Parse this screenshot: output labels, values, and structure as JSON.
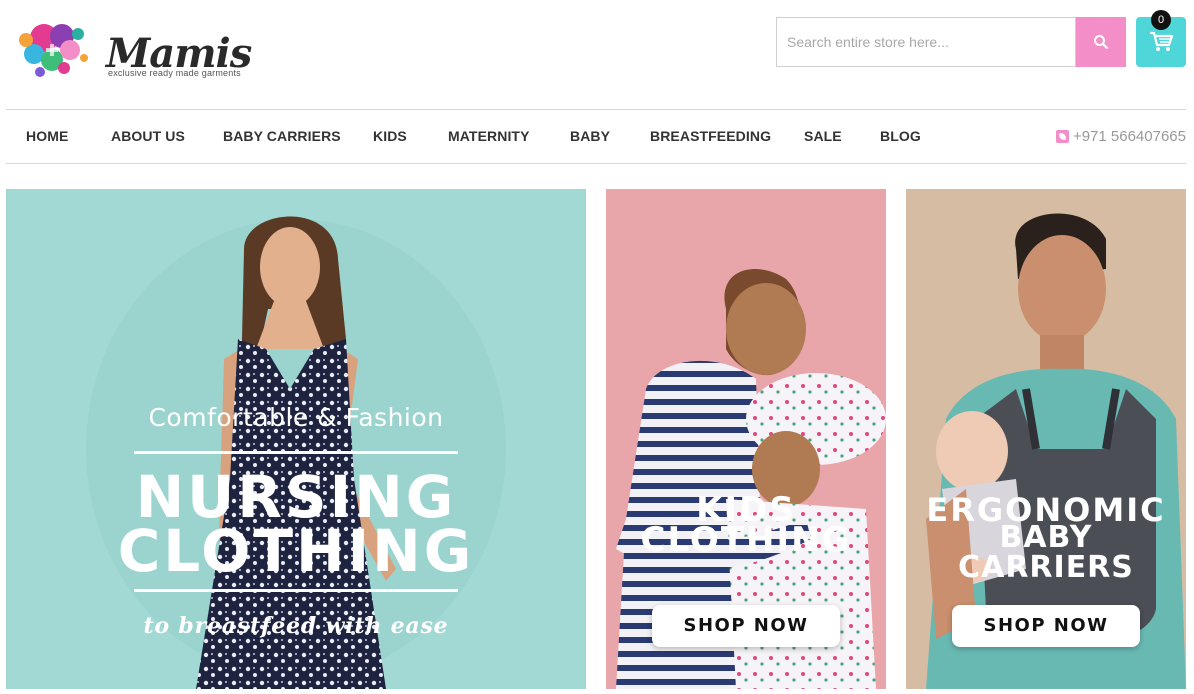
{
  "brand": {
    "name": "Mamis",
    "tagline": "exclusive ready made garments"
  },
  "search": {
    "placeholder": "Search entire store here...",
    "button_icon": "search-icon"
  },
  "cart": {
    "icon": "shopping-cart-icon",
    "count": "0"
  },
  "nav": {
    "items": [
      {
        "label": "HOME"
      },
      {
        "label": "ABOUT US"
      },
      {
        "label": "BABY CARRIERS"
      },
      {
        "label": "KIDS"
      },
      {
        "label": "MATERNITY"
      },
      {
        "label": "BABY"
      },
      {
        "label": "BREASTFEEDING"
      },
      {
        "label": "SALE"
      },
      {
        "label": "BLOG"
      }
    ],
    "phone": "+971 566407665",
    "phone_icon": "phone-icon"
  },
  "banners": {
    "main": {
      "subtitle": "Comfortable & Fashion",
      "title_line1": "NURSING",
      "title_line2": "CLOTHING",
      "tagline": "to breastfeed with ease"
    },
    "kids": {
      "title_line1": "KIDS",
      "title_line2": "CLOTHING",
      "button": "SHOP NOW"
    },
    "carriers": {
      "title_line1": "ERGONOMIC",
      "title_line2": "BABY CARRIERS",
      "button": "SHOP NOW"
    }
  },
  "colors": {
    "accent_pink": "#f48ec8",
    "accent_teal": "#4fd6d9",
    "banner_teal": "#a2d9d5",
    "banner_pink": "#e9a6aa",
    "banner_beige": "#d7bca4"
  }
}
